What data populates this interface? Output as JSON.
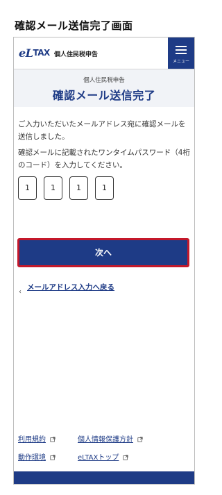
{
  "caption": "確認メール送信完了画面",
  "header": {
    "logo_main": "eL",
    "logo_tax": "TAX",
    "app_name": "個人住民税申告",
    "menu_label": "メニュー"
  },
  "title_area": {
    "sub_title": "個人住民税申告",
    "main_title": "確認メール送信完了"
  },
  "description": {
    "line1": "ご入力いただいたメールアドレス宛に確認メールを送信しました。",
    "line2": "確認メールに記載されたワンタイムパスワード（4桁のコード）を入力してください。"
  },
  "code_inputs": [
    "1",
    "1",
    "1",
    "1"
  ],
  "next_button": {
    "label": "次へ"
  },
  "back_link": {
    "label": "メールアドレス入力へ戻る",
    "chevron": "‹"
  },
  "footer": {
    "links": [
      {
        "label": "利用規約"
      },
      {
        "label": "個人情報保護方針"
      },
      {
        "label": "動作環境"
      },
      {
        "label": "eLTAXトップ"
      }
    ]
  },
  "colors": {
    "primary": "#1e3b86",
    "highlight_border": "#c4182a",
    "title_bg": "#f1f3f7"
  }
}
